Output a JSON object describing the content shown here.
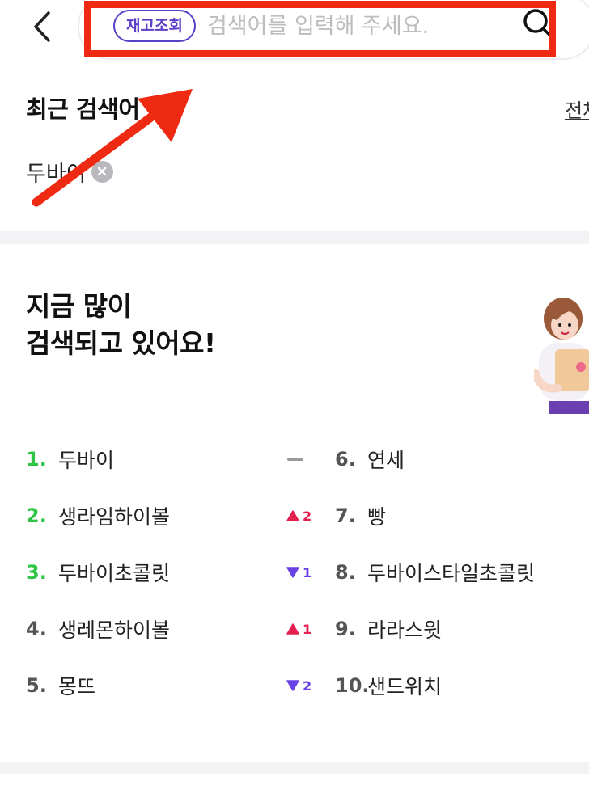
{
  "header": {
    "back_icon": "chevron-left-icon",
    "stock_tag": "재고조회",
    "search_placeholder": "검색어를 입력해 주세요.",
    "search_icon": "search-icon",
    "highlight_color": "#ee2a12",
    "tag_color": "#5b3ec8"
  },
  "recent": {
    "title": "최근 검색어",
    "clear_label": "전체",
    "items": [
      {
        "label": "두바이",
        "remove_icon": "close-circle-icon"
      }
    ]
  },
  "popular": {
    "title_line1": "지금 많이",
    "title_line2": "검색되고 있어요!",
    "illustration": "shopper-girl-illustration",
    "rankings": [
      {
        "rank": "1.",
        "term": "두바이",
        "trend": ""
      },
      {
        "rank": "2.",
        "term": "생라임하이볼",
        "trend": ""
      },
      {
        "rank": "3.",
        "term": "두바이초콜릿",
        "trend": ""
      },
      {
        "rank": "4.",
        "term": "생레몬하이볼",
        "trend": ""
      },
      {
        "rank": "5.",
        "term": "몽뜨",
        "trend": ""
      },
      {
        "rank": "6.",
        "term": "연세",
        "trend": "same",
        "change": ""
      },
      {
        "rank": "7.",
        "term": "빵",
        "trend": "up",
        "change": "2"
      },
      {
        "rank": "8.",
        "term": "두바이스타일초콜릿",
        "trend": "down",
        "change": "1"
      },
      {
        "rank": "9.",
        "term": "라라스윗",
        "trend": "up",
        "change": "1"
      },
      {
        "rank": "10.",
        "term": "샌드위치",
        "trend": "down",
        "change": "2"
      }
    ],
    "colors": {
      "top_rank": "#2fc546",
      "up": "#e3204f",
      "down": "#6a41e4"
    }
  }
}
